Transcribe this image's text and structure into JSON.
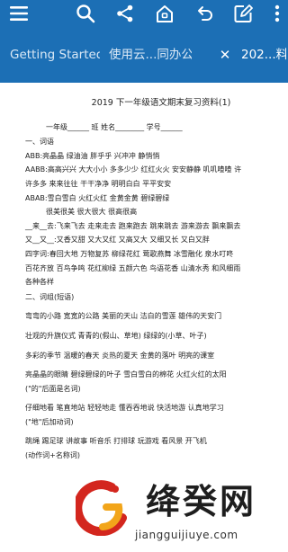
{
  "toolbar": {
    "menu_icon": "hamburger-menu-icon",
    "search_icon": "search-icon",
    "share_icon": "share-icon",
    "home_icon": "home-icon",
    "undo_icon": "undo-icon",
    "edit_icon": "edit-icon",
    "more_icon": "more-vertical-icon"
  },
  "tabs": [
    {
      "label": "Getting Started"
    },
    {
      "label": "使用云...同办公"
    },
    {
      "label": "202...料"
    }
  ],
  "tab_close": "✕",
  "document": {
    "title": "2019 下一年级语文期末复习资料(1)",
    "lines": [
      "一年级______ 班        姓名________ 学号______",
      "一、词语",
      "ABB:亮晶晶     绿油油   胖乎乎   兴冲冲   静悄悄",
      "AABB:高高兴兴   大大小小   多多少少   红红火火   安安静静   叽叽喳喳   许",
      "许多多    来来往往    干干净净    明明白白    平平安安",
      "ABAB:雪白雪白  火红火红  金黄金黄  碧绿碧绿",
      "很美很美   很大很大   很高很高",
      "__来__去:飞来飞去  走来走去  跑来跑去  跳来跳去  游来游去  飘来飘去",
      "又__又__:又香又甜   又大又红   又高又大   又细又长   又白又胖",
      "四字词:春回大地   万物复苏   柳绿花红   莺歌燕舞   冰雪融化   泉水叮咚",
      "百花齐放  百鸟争鸣   花红柳绿   五颜六色   鸟语花香   山清水秀   和风细雨",
      "各种各样",
      "二、词组(短语)",
      "弯弯的小路    宽宽的公路    美丽的天山    洁白的雪莲    雄伟的天安门",
      "壮观的升旗仪式    青青的(假山、草地)    绿绿的(小草、叶子)",
      "多彩的季节    温暖的春天    炎热的夏天    金黄的落叶    明亮的课室",
      "亮晶晶的眼睛   碧绿碧绿的叶子    雪白雪白的棉花    火红火红的太阳",
      "(\"的\"后面是名词)",
      "仔细地看    笔直地站    轻轻地走    懂吞吞地说    快活地游    认真地学习",
      "(\"地\"后加动词)",
      "跳绳    踢足球    讲故事    听音乐    打排球    玩游戏    看风景    开飞机",
      "(动作词+名称词)"
    ]
  },
  "watermark": {
    "logo": "jiangguijiuye-logo",
    "name": "绛癸网",
    "domain": "jiangguijiuye.com"
  },
  "colors": {
    "accent": "#1c6fb5",
    "logo_red": "#d3261e",
    "logo_orange": "#f2a51a"
  }
}
